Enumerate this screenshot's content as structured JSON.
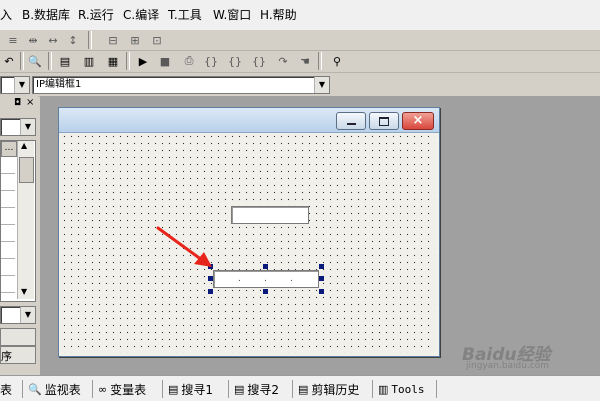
{
  "menu": {
    "items": [
      "入",
      "B.数据库",
      "R.运行",
      "C.编译",
      "T.工具",
      "W.窗口",
      "H.帮助"
    ]
  },
  "toolbar2": {
    "combo_left_value": "",
    "combo_main_value": "IP编辑框1"
  },
  "left_panel": {
    "grid_button": "…",
    "bottom_labels": [
      "",
      "序"
    ]
  },
  "tabs": [
    "表",
    "监视表",
    "变量表",
    "搜寻1",
    "搜寻2",
    "剪辑历史",
    "Tools"
  ],
  "watermark": {
    "text": "Baidu经验",
    "url": "jingyan.baidu.com"
  },
  "icons": {
    "title_minimize": "minimize-icon",
    "title_maximize": "maximize-icon",
    "title_close": "close-icon",
    "annotation": "red-arrow"
  },
  "colors": {
    "close_button": "#d9473c",
    "arrow": "#e8251a",
    "selection_handle": "#0a1a7a"
  }
}
